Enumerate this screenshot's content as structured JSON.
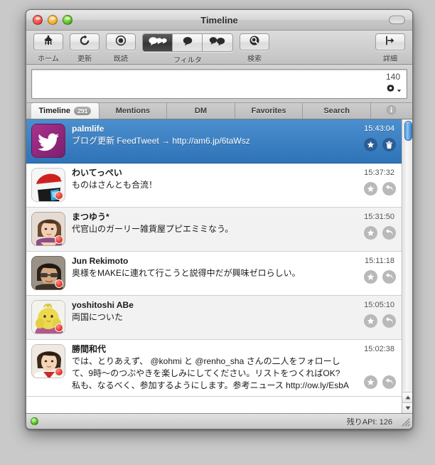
{
  "window": {
    "title": "Timeline",
    "controls": {
      "close": "close-button",
      "minimize": "minimize-button",
      "zoom": "zoom-button"
    },
    "toolbar_toggle": "toolbar-toggle-button"
  },
  "toolbar": {
    "items": [
      {
        "label": "ホーム",
        "icon": "home-icon",
        "name": "home-button"
      },
      {
        "label": "更新",
        "icon": "refresh-icon",
        "name": "refresh-button"
      },
      {
        "label": "既読",
        "icon": "mark-read-icon",
        "name": "mark-read-button"
      }
    ],
    "filter": {
      "label": "フィルタ",
      "options": [
        {
          "icon": "all-tweets-icon",
          "name": "filter-all",
          "selected": true
        },
        {
          "icon": "single-bubble-icon",
          "name": "filter-single",
          "selected": false
        },
        {
          "icon": "double-bubble-icon",
          "name": "filter-conversation",
          "selected": false
        }
      ]
    },
    "search": {
      "label": "検索",
      "icon": "search-icon",
      "name": "search-button"
    },
    "detail": {
      "label": "詳細",
      "icon": "detail-icon",
      "name": "detail-button"
    }
  },
  "compose": {
    "value": "",
    "placeholder": "",
    "char_count": "140",
    "gear_icon": "gear-icon"
  },
  "tabs": [
    {
      "label": "Timeline",
      "badge": "291",
      "selected": true,
      "name": "tab-timeline"
    },
    {
      "label": "Mentions",
      "badge": "",
      "selected": false,
      "name": "tab-mentions"
    },
    {
      "label": "DM",
      "badge": "",
      "selected": false,
      "name": "tab-dm"
    },
    {
      "label": "Favorites",
      "badge": "",
      "selected": false,
      "name": "tab-favorites"
    },
    {
      "label": "Search",
      "badge": "",
      "selected": false,
      "name": "tab-search"
    }
  ],
  "tab_info_icon": "info-icon",
  "tweets": [
    {
      "screen_name": "palmlife",
      "text": "ブログ更新 FeedTweet → http://am6.jp/6taWsz",
      "timestamp": "15:43:04",
      "selected": true,
      "unread": false,
      "avatar": "twitter-bird-avatar",
      "actions": [
        {
          "icon": "star-icon",
          "name": "favorite-button"
        },
        {
          "icon": "trash-icon",
          "name": "delete-button"
        }
      ]
    },
    {
      "screen_name": "わいてっぺい",
      "text": "ものはさんとも合流！",
      "timestamp": "15:37:32",
      "selected": false,
      "unread": true,
      "avatar": "santa-hat-avatar",
      "actions": [
        {
          "icon": "star-icon",
          "name": "favorite-button"
        },
        {
          "icon": "reply-icon",
          "name": "reply-button"
        }
      ]
    },
    {
      "screen_name": "まつゆう*",
      "text": "代官山のガーリー雑貨屋プピエミミなう。",
      "timestamp": "15:31:50",
      "selected": false,
      "unread": true,
      "avatar": "woman-portrait-avatar",
      "actions": [
        {
          "icon": "star-icon",
          "name": "favorite-button"
        },
        {
          "icon": "reply-icon",
          "name": "reply-button"
        }
      ]
    },
    {
      "screen_name": "Jun Rekimoto",
      "text": "奥様をMAKEに連れて行こうと説得中だが興味ゼロらしい。",
      "timestamp": "15:11:18",
      "selected": false,
      "unread": true,
      "avatar": "man-glasses-avatar",
      "actions": [
        {
          "icon": "star-icon",
          "name": "favorite-button"
        },
        {
          "icon": "reply-icon",
          "name": "reply-button"
        }
      ]
    },
    {
      "screen_name": "yoshitoshi ABe",
      "text": "両国についた",
      "timestamp": "15:05:10",
      "selected": false,
      "unread": true,
      "avatar": "yellow-chick-avatar",
      "actions": [
        {
          "icon": "star-icon",
          "name": "favorite-button"
        },
        {
          "icon": "reply-icon",
          "name": "reply-button"
        }
      ]
    },
    {
      "screen_name": "勝間和代",
      "text": "では、とりあえず、 @kohmi と @renho_sha さんの二人をフォローして、9時〜のつぶやきを楽しみにしてください。リストをつくればOK? 私も、なるべく、参加するようにします。参考ニュース http://ow.ly/EsbA",
      "timestamp": "15:02:38",
      "selected": false,
      "unread": true,
      "avatar": "woman-red-dress-avatar",
      "actions": [
        {
          "icon": "star-icon",
          "name": "favorite-button"
        },
        {
          "icon": "reply-icon",
          "name": "reply-button"
        }
      ]
    }
  ],
  "scrollbar": {
    "up_arrow": "scroll-up-arrow",
    "down_arrow": "scroll-down-arrow"
  },
  "statusbar": {
    "led": "connection-status-led",
    "text": "残りAPI: 126"
  },
  "colors": {
    "selection_blue": "#2f73b8",
    "accent_red": "#e02b1d",
    "status_green": "#4cc31a"
  }
}
